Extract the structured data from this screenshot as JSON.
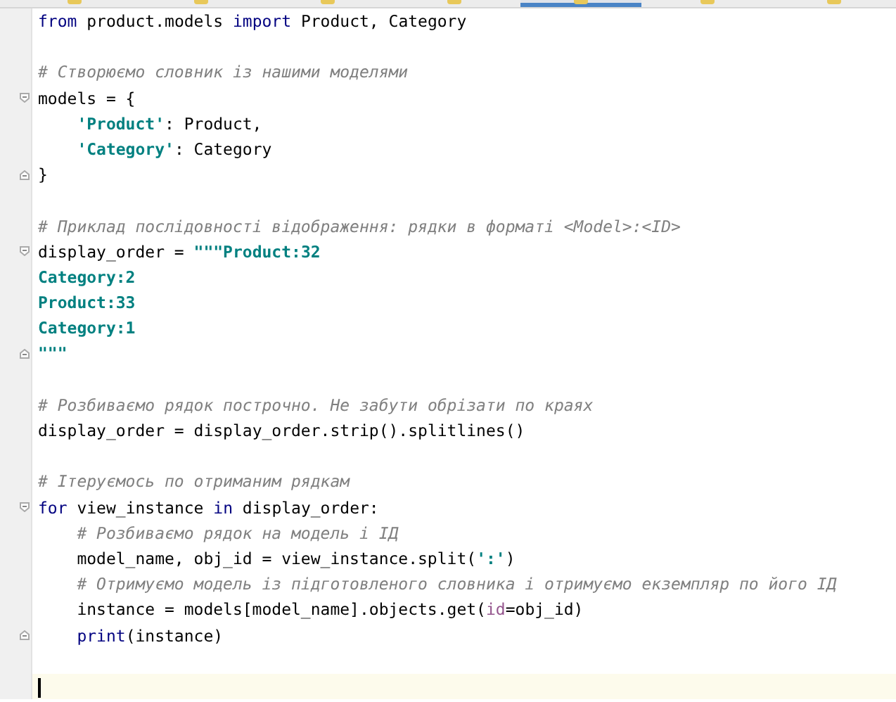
{
  "tabs": [
    {
      "selected": false
    },
    {
      "selected": false
    },
    {
      "selected": false
    },
    {
      "selected": false
    },
    {
      "selected": true
    },
    {
      "selected": false
    },
    {
      "selected": false
    }
  ],
  "lines": [
    {
      "current": false,
      "tokens": [
        {
          "kind": "keyword",
          "text": "from"
        },
        {
          "kind": "plain",
          "text": " product.models "
        },
        {
          "kind": "keyword",
          "text": "import"
        },
        {
          "kind": "plain",
          "text": " Product, Category"
        }
      ]
    },
    {
      "current": false
    },
    {
      "current": false,
      "tokens": [
        {
          "kind": "comment",
          "text": "# Створюємо словник із нашими моделями"
        }
      ]
    },
    {
      "current": false,
      "fold_start": true,
      "tokens": [
        {
          "kind": "plain",
          "text": "models = {"
        }
      ]
    },
    {
      "current": false,
      "indent": true,
      "tokens": [
        {
          "kind": "string",
          "text": "'Product'"
        },
        {
          "kind": "plain",
          "text": ": Product,"
        }
      ]
    },
    {
      "current": false,
      "indent": true,
      "tokens": [
        {
          "kind": "string",
          "text": "'Category'"
        },
        {
          "kind": "plain",
          "text": ": Category"
        }
      ]
    },
    {
      "current": false,
      "fold_end": true,
      "tokens": [
        {
          "kind": "plain",
          "text": "}"
        }
      ]
    },
    {
      "current": false
    },
    {
      "current": false,
      "tokens": [
        {
          "kind": "comment",
          "text": "# Приклад послідовності відображення: рядки в форматі <Model>:<ID>"
        }
      ]
    },
    {
      "current": false,
      "fold_start": true,
      "tokens": [
        {
          "kind": "plain",
          "text": "display_order = "
        },
        {
          "kind": "string",
          "text": "\"\"\"Product:32"
        }
      ]
    },
    {
      "current": false,
      "tokens": [
        {
          "kind": "string",
          "text": "Category:2"
        }
      ]
    },
    {
      "current": false,
      "tokens": [
        {
          "kind": "string",
          "text": "Product:33"
        }
      ]
    },
    {
      "current": false,
      "tokens": [
        {
          "kind": "string",
          "text": "Category:1"
        }
      ]
    },
    {
      "current": false,
      "fold_end": true,
      "tokens": [
        {
          "kind": "string",
          "text": "\"\"\""
        }
      ]
    },
    {
      "current": false
    },
    {
      "current": false,
      "tokens": [
        {
          "kind": "comment",
          "text": "# Розбиваємо рядок построчно. Не забути обрізати по краях"
        }
      ]
    },
    {
      "current": false,
      "tokens": [
        {
          "kind": "plain",
          "text": "display_order = display_order.strip().splitlines()"
        }
      ]
    },
    {
      "current": false
    },
    {
      "current": false,
      "tokens": [
        {
          "kind": "comment",
          "text": "# Ітеруємось по отриманим рядкам"
        }
      ]
    },
    {
      "current": false,
      "fold_start": true,
      "tokens": [
        {
          "kind": "keyword",
          "text": "for"
        },
        {
          "kind": "plain",
          "text": " view_instance "
        },
        {
          "kind": "keyword",
          "text": "in"
        },
        {
          "kind": "plain",
          "text": " display_order:"
        }
      ]
    },
    {
      "current": false,
      "indent": true,
      "tokens": [
        {
          "kind": "comment",
          "text": "# Розбиваємо рядок на модель і ІД"
        }
      ]
    },
    {
      "current": false,
      "indent": true,
      "tokens": [
        {
          "kind": "plain",
          "text": "model_name, obj_id = view_instance.split("
        },
        {
          "kind": "string",
          "text": "':'"
        },
        {
          "kind": "plain",
          "text": ")"
        }
      ]
    },
    {
      "current": false,
      "indent": true,
      "tokens": [
        {
          "kind": "comment",
          "text": "# Отримуємо модель із підготовленого словника і отримуємо екземпляр по його ІД"
        }
      ]
    },
    {
      "current": false,
      "indent": true,
      "tokens": [
        {
          "kind": "plain",
          "text": "instance = models[model_name].objects.get("
        },
        {
          "kind": "param",
          "text": "id"
        },
        {
          "kind": "plain",
          "text": "=obj_id)"
        }
      ]
    },
    {
      "current": false,
      "indent": true,
      "fold_end": true,
      "tokens": [
        {
          "kind": "builtin",
          "text": "print"
        },
        {
          "kind": "plain",
          "text": "(instance)"
        }
      ]
    },
    {
      "current": false
    },
    {
      "current": true
    }
  ]
}
